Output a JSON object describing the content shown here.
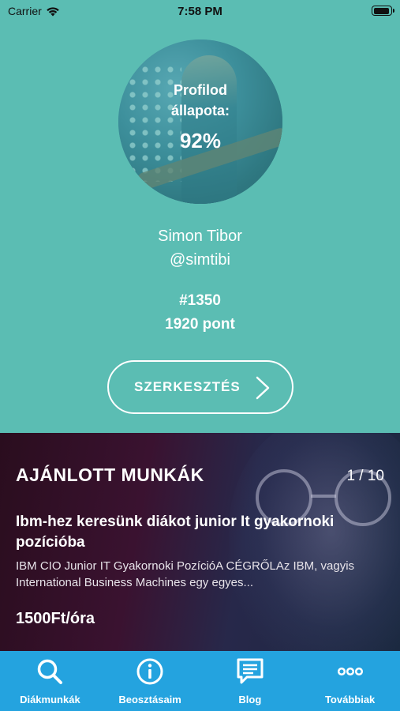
{
  "status_bar": {
    "carrier": "Carrier",
    "time": "7:58 PM"
  },
  "profile": {
    "avatar_label": "Profilod állapota:",
    "completion": "92%",
    "name": "Simon Tibor",
    "username": "@simtibi",
    "rank": "#1350",
    "points": "1920 pont",
    "edit_label": "SZERKESZTÉS"
  },
  "jobs": {
    "title": "AJÁNLOTT MUNKÁK",
    "pager": "1 / 10",
    "job_title": "Ibm-hez keresünk diákot junior It gyakornoki pozícióba",
    "job_description": "IBM CIO Junior IT Gyakornoki PozícióA CÉGRŐLAz IBM, vagyis International Business Machines egy egyes...",
    "wage": "1500Ft/óra"
  },
  "tabbar": {
    "items": [
      {
        "label": "Diákmunkák",
        "icon": "search-icon"
      },
      {
        "label": "Beosztásaim",
        "icon": "info-icon"
      },
      {
        "label": "Blog",
        "icon": "chat-icon"
      },
      {
        "label": "Továbbiak",
        "icon": "more-icon"
      }
    ]
  },
  "colors": {
    "profile_bg": "#5bbdb3",
    "tabbar_bg": "#24a3df"
  }
}
